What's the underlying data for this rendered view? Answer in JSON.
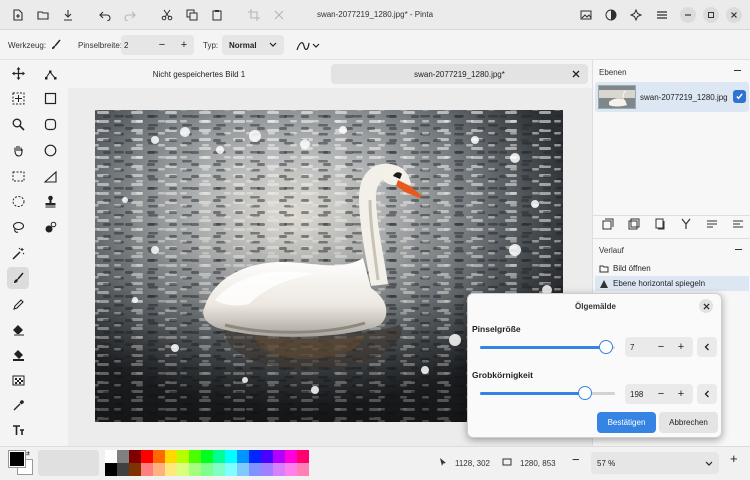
{
  "window": {
    "title": "swan-2077219_1280.jpg* - Pinta"
  },
  "toolbar": {
    "tool_label": "Werkzeug:",
    "brush_width_label": "Pinselbreite:",
    "brush_width_value": "2",
    "type_label": "Typ:",
    "type_value": "Normal"
  },
  "tabs": [
    {
      "label": "Nicht gespeichertes Bild 1"
    },
    {
      "label": "swan-2077219_1280.jpg*"
    }
  ],
  "layers": {
    "title": "Ebenen",
    "items": [
      {
        "name": "swan-2077219_1280.jpg",
        "visible": true
      }
    ]
  },
  "history": {
    "title": "Verlauf",
    "items": [
      {
        "label": "Bild öffnen"
      },
      {
        "label": "Ebene horizontal spiegeln"
      }
    ]
  },
  "dialog": {
    "title": "Ölgemälde",
    "brush_size_label": "Pinselgröße",
    "brush_size_value": "7",
    "brush_size_level": 0.93,
    "coarseness_label": "Grobkörnigkeit",
    "coarseness_value": "198",
    "coarseness_level": 0.78,
    "ok_label": "Bestätigen",
    "cancel_label": "Abbrechen"
  },
  "status": {
    "cursor_pos": "1128, 302",
    "selection_size": "1280, 853",
    "zoom": "57 %"
  },
  "colors": {
    "accent": "#3584e4",
    "primary": "#000000",
    "secondary": "#ffffff",
    "palette_top": [
      "#ffffff",
      "#808080",
      "#7f0000",
      "#ff0000",
      "#ff6a00",
      "#ffd800",
      "#b6ff00",
      "#4cff00",
      "#00ff21",
      "#00ff90",
      "#00ffff",
      "#0094ff",
      "#0026ff",
      "#4800ff",
      "#b200ff",
      "#ff00dc",
      "#ff006e"
    ],
    "palette_bottom": [
      "#000000",
      "#404040",
      "#7f3300",
      "#ff7f7f",
      "#ffb27f",
      "#ffe97f",
      "#daff7f",
      "#a5ff7f",
      "#7fff8e",
      "#7fffc5",
      "#7fffff",
      "#7fc9ff",
      "#7f92ff",
      "#a17fff",
      "#d67fff",
      "#ff7fed",
      "#ff7fb6"
    ]
  }
}
